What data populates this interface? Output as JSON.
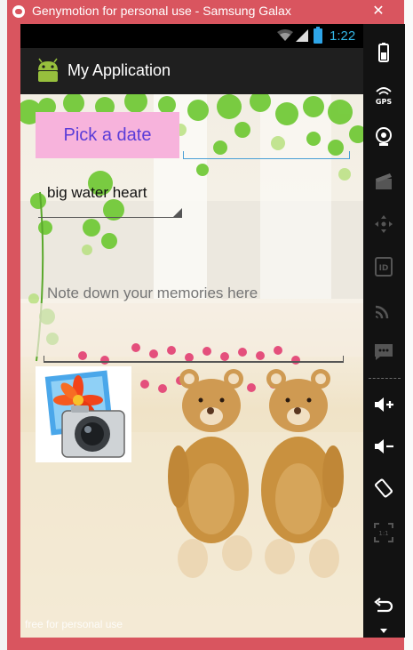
{
  "window": {
    "title": "Genymotion for personal use - Samsung Galax",
    "close_glyph": "✕"
  },
  "status_bar": {
    "time": "1:22",
    "accent": "#33b5e5"
  },
  "action_bar": {
    "app_title": "My Application",
    "icon": "android-icon"
  },
  "form": {
    "date_button": "Pick a date",
    "date_value": "",
    "spinner_selected": "big water heart",
    "memories_placeholder": "Note down your memories here",
    "photo_button_icon": "camera-photo-icon"
  },
  "watermark": "free for personal use",
  "sidebar": {
    "items": [
      "battery-icon",
      "gps-icon",
      "webcam-icon",
      "clapper-icon",
      "dpad-icon",
      "id-icon",
      "cast-icon",
      "sms-icon",
      "volume-up-icon",
      "volume-down-icon",
      "rotate-icon",
      "scale-icon",
      "back-icon",
      "menu-icon"
    ],
    "gps_label": "GPS",
    "id_label": "ID",
    "scale_label": "1:1"
  },
  "colors": {
    "window_frame": "#d9555f",
    "button_bg": "#f7b3dc",
    "button_text": "#5a3cd8"
  }
}
